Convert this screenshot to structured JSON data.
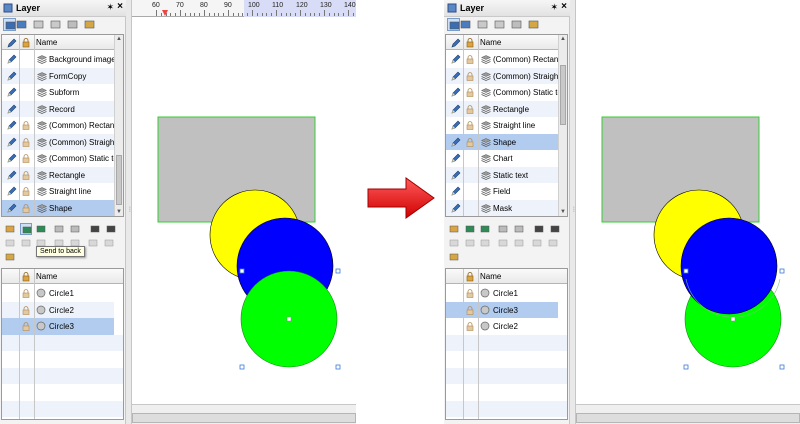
{
  "panel_title": "Layer",
  "pin_glyph": "✶",
  "close_glyph": "×",
  "name_header": "Name",
  "tooltip": "Send to back",
  "ruler_labels": [
    "60",
    "70",
    "80",
    "90",
    "100",
    "110",
    "120",
    "130",
    "140",
    "150"
  ],
  "left": {
    "layers": [
      {
        "label": "Background image",
        "locked": false,
        "selected": false
      },
      {
        "label": "FormCopy",
        "locked": false,
        "selected": false
      },
      {
        "label": "Subform",
        "locked": false,
        "selected": false
      },
      {
        "label": "Record",
        "locked": false,
        "selected": false
      },
      {
        "label": "(Common) Rectangle",
        "locked": true,
        "selected": false
      },
      {
        "label": "(Common) Straight line",
        "locked": true,
        "selected": false
      },
      {
        "label": "(Common) Static text",
        "locked": true,
        "selected": false
      },
      {
        "label": "Rectangle",
        "locked": true,
        "selected": false
      },
      {
        "label": "Straight line",
        "locked": true,
        "selected": false
      },
      {
        "label": "Shape",
        "locked": true,
        "selected": true
      }
    ],
    "shapes": [
      {
        "label": "Circle1",
        "selected": false
      },
      {
        "label": "Circle2",
        "selected": false
      },
      {
        "label": "Circle3",
        "selected": true
      }
    ]
  },
  "right": {
    "layers": [
      {
        "label": "(Common) Rectangle",
        "locked": true,
        "selected": false
      },
      {
        "label": "(Common) Straight line",
        "locked": true,
        "selected": false
      },
      {
        "label": "(Common) Static text",
        "locked": true,
        "selected": false
      },
      {
        "label": "Rectangle",
        "locked": true,
        "selected": false
      },
      {
        "label": "Straight line",
        "locked": true,
        "selected": false
      },
      {
        "label": "Shape",
        "locked": true,
        "selected": true
      },
      {
        "label": "Chart",
        "locked": false,
        "selected": false
      },
      {
        "label": "Static text",
        "locked": false,
        "selected": false
      },
      {
        "label": "Field",
        "locked": false,
        "selected": false
      },
      {
        "label": "Mask",
        "locked": false,
        "selected": false
      }
    ],
    "shapes": [
      {
        "label": "Circle1",
        "selected": false
      },
      {
        "label": "Circle3",
        "selected": true
      },
      {
        "label": "Circle2",
        "selected": false
      }
    ]
  },
  "colors": {
    "selection": "#b2ccef",
    "rect_fill": "#c0c0c0",
    "rect_border": "#33cc33",
    "yellow": "#ffff00",
    "blue": "#0000ff",
    "green": "#00ff00",
    "arrow": "#ee1111"
  },
  "icons": {
    "edit": "pencil-icon",
    "lock": "lock-icon",
    "layer": "layer-stack-icon",
    "shape": "circle-shape-icon",
    "arrow": "red-right-arrow"
  }
}
